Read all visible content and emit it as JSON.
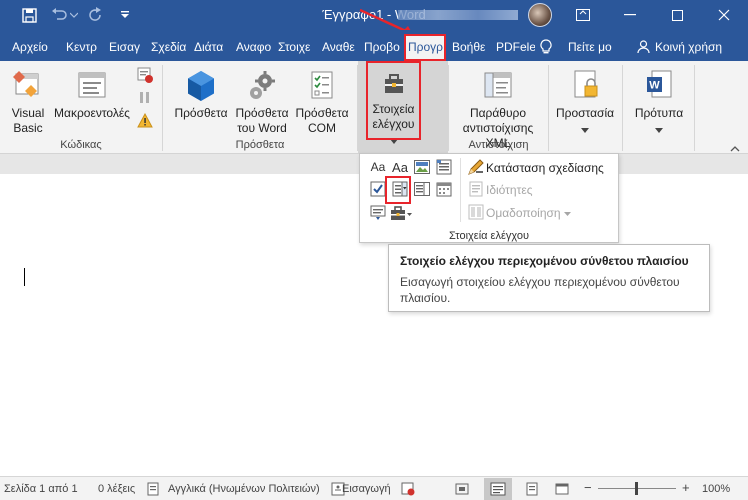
{
  "titlebar": {
    "title": "Έγγραφο1 - Word",
    "minimize_symbol": "—",
    "close_symbol": "✕",
    "bg_color": "#2b579a"
  },
  "tabs": [
    {
      "label": "Αρχείο"
    },
    {
      "label": "Κεντρ"
    },
    {
      "label": "Εισαγ"
    },
    {
      "label": "Σχεδία"
    },
    {
      "label": "Διάτα"
    },
    {
      "label": "Αναφο"
    },
    {
      "label": "Στοιχε"
    },
    {
      "label": "Αναθε"
    },
    {
      "label": "Προβο"
    },
    {
      "label": "Προγρ",
      "active": true
    },
    {
      "label": "Βοήθε"
    },
    {
      "label": "PDFele"
    },
    {
      "label": "Πείτε μο"
    },
    {
      "label": "Κοινή χρήση"
    }
  ],
  "ribbon": {
    "groups": {
      "code": "Κώδικας",
      "addins": "Πρόσθετα",
      "mapping": "Αντιστοίχιση"
    },
    "buttons": {
      "visual_basic_1": "Visual",
      "visual_basic_2": "Basic",
      "macros": "Μακροεντολές",
      "addins": "Πρόσθετα",
      "word_addins_1": "Πρόσθετα",
      "word_addins_2": "του Word",
      "com_addins_1": "Πρόσθετα",
      "com_addins_2": "COM",
      "controls_1": "Στοιχεία",
      "controls_2": "ελέγχου",
      "xml_pane_1": "Παράθυρο",
      "xml_pane_2": "αντιστοίχισης XML",
      "protect": "Προστασία",
      "templates": "Πρότυπα"
    }
  },
  "controls_panel": {
    "design_mode": "Κατάσταση σχεδίασης",
    "properties": "Ιδιότητες",
    "group": "Ομαδοποίηση",
    "label": "Στοιχεία ελέγχου",
    "rich_text_glyph": "Aa",
    "plain_text_glyph": "Aa"
  },
  "tooltip": {
    "title": "Στοιχείο ελέγχου περιεχομένου σύνθετου πλαισίου",
    "body": "Εισαγωγή στοιχείου ελέγχου περιεχομένου σύνθετου πλαισίου."
  },
  "status": {
    "page": "Σελίδα 1 από 1",
    "words": "0 λέξεις",
    "language": "Αγγλικά (Ηνωμένων Πολιτειών)",
    "mode": "Εισαγωγή",
    "zoom": "100%",
    "zoom_minus": "−",
    "zoom_plus": "+"
  },
  "colors": {
    "accent": "#2b579a",
    "highlight": "#e8242b"
  }
}
